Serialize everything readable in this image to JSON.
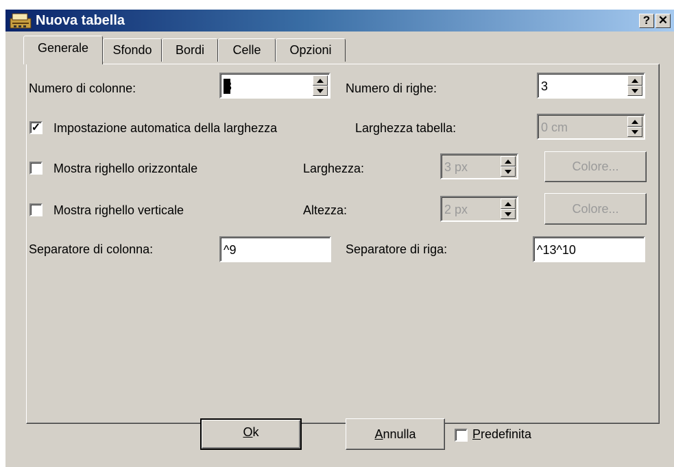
{
  "window": {
    "title": "Nuova tabella",
    "help_glyph": "?",
    "close_glyph": "✕",
    "titlebar_color": "#0a246a",
    "face_color": "#d4d0c8",
    "icon": "app-typewriter-icon"
  },
  "tabs": [
    {
      "label": "Generale",
      "active": true
    },
    {
      "label": "Sfondo",
      "active": false
    },
    {
      "label": "Bordi",
      "active": false
    },
    {
      "label": "Celle",
      "active": false
    },
    {
      "label": "Opzioni",
      "active": false
    }
  ],
  "general": {
    "columns": {
      "label": "Numero di colonne:",
      "value": "3"
    },
    "rows": {
      "label": "Numero di righe:",
      "value": "3"
    },
    "auto_width": {
      "label": "Impostazione automatica della larghezza",
      "checked": true
    },
    "table_width": {
      "label": "Larghezza tabella:",
      "value": "0 cm",
      "disabled": true
    },
    "h_ruler": {
      "label": "Mostra righello orizzontale",
      "checked": false
    },
    "ruler_width": {
      "label": "Larghezza:",
      "value": "3 px",
      "disabled": true
    },
    "color_1": {
      "label": "Colore...",
      "disabled": true
    },
    "v_ruler": {
      "label": "Mostra righello verticale",
      "checked": false
    },
    "ruler_height": {
      "label": "Altezza:",
      "value": "2 px",
      "disabled": true
    },
    "color_2": {
      "label": "Colore...",
      "disabled": true
    },
    "col_sep": {
      "label": "Separatore di colonna:",
      "value": "^9"
    },
    "row_sep": {
      "label": "Separatore di riga:",
      "value": "^13^10"
    }
  },
  "footer": {
    "ok_accel": "O",
    "ok_rest": "k",
    "cancel_accel": "A",
    "cancel_rest": "nnulla",
    "default_accel": "P",
    "default_rest": "redefinita",
    "default_checked": false
  }
}
